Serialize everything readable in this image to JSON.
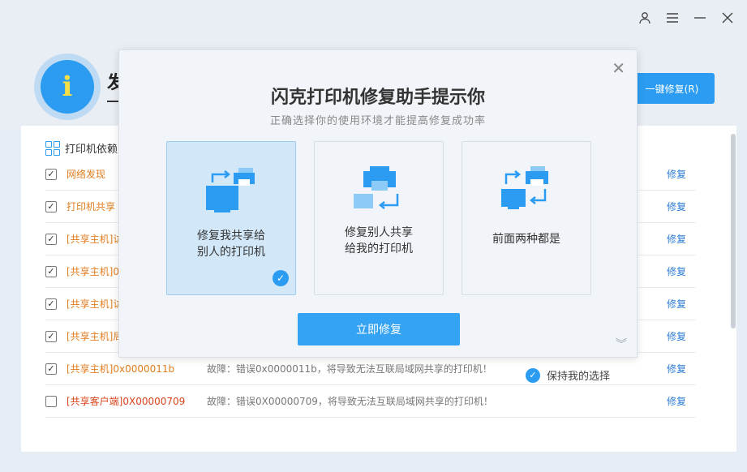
{
  "header": {
    "title": "发",
    "fix_all_label": "一键修复(R)",
    "badge_glyph": "i"
  },
  "window_controls": [
    "user-icon",
    "menu-icon",
    "minimize-icon",
    "close-icon"
  ],
  "panel": {
    "heading": "打印机依赖",
    "rows": [
      {
        "name": "网络发现",
        "desc": "",
        "fix": "修复",
        "checked": true
      },
      {
        "name": "打印机共享",
        "desc": "",
        "fix": "修复",
        "checked": true
      },
      {
        "name": "[共享主机]访",
        "desc": "",
        "fix": "修复",
        "checked": true
      },
      {
        "name": "[共享主机]0",
        "desc": "",
        "fix": "修复",
        "checked": true
      },
      {
        "name": "[共享主机]访",
        "desc": "",
        "fix": "修复",
        "checked": true
      },
      {
        "name": "[共享主机]局",
        "desc": "",
        "fix": "修复",
        "checked": true
      },
      {
        "name": "[共享主机]0x0000011b",
        "desc": "故障：错误0x0000011b，将导致无法互联局域网共享的打印机！",
        "fix": "修复",
        "checked": true
      },
      {
        "name": "[共享客户端]0X00000709",
        "desc": "故障：错误0X00000709，将导致无法互联局域网共享的打印机！",
        "fix": "修复",
        "checked": false
      }
    ],
    "keep_choice": "保持我的选择"
  },
  "modal": {
    "title": "闪克打印机修复助手提示你",
    "subtitle": "正确选择你的使用环境才能提高修复成功率",
    "options": [
      {
        "label": "修复我共享给\n别人的打印机",
        "selected": true
      },
      {
        "label": "修复别人共享\n给我的打印机",
        "selected": false
      },
      {
        "label": "前面两种都是",
        "selected": false
      }
    ],
    "button": "立即修复"
  },
  "colors": {
    "accent": "#2b9cf2",
    "warn": "#e07d1e",
    "error": "#d9441b",
    "link": "#2b7bd6"
  }
}
